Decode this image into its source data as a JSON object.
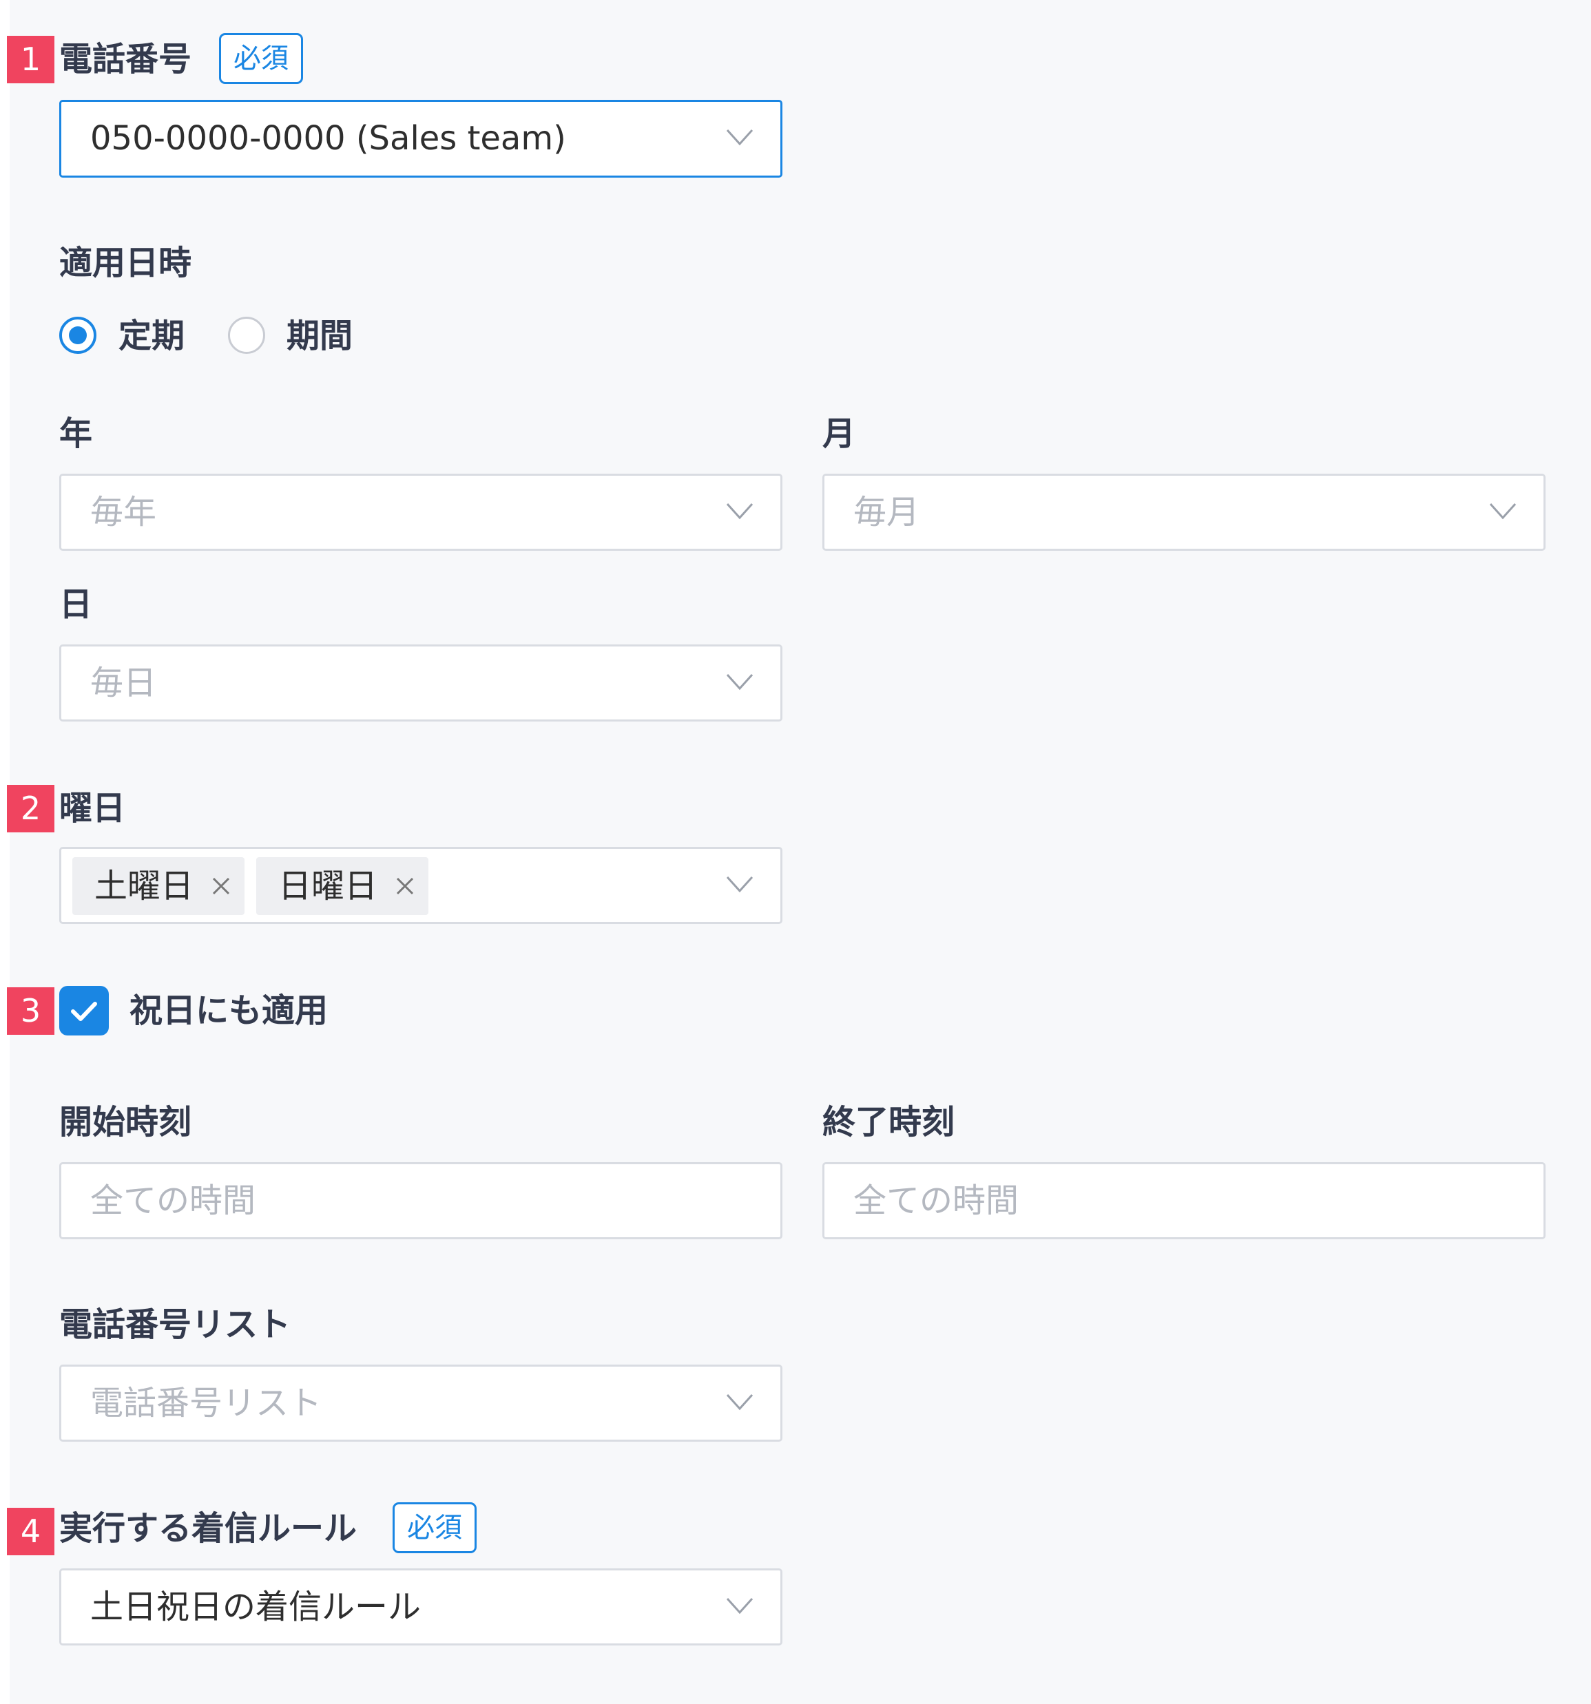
{
  "sections": {
    "phone": {
      "marker": "1",
      "label": "電話番号",
      "required_badge": "必須",
      "value": "050-0000-0000 (Sales team)"
    },
    "apply_datetime": {
      "label": "適用日時",
      "options": [
        {
          "label": "定期",
          "selected": true
        },
        {
          "label": "期間",
          "selected": false
        }
      ]
    },
    "year": {
      "label": "年",
      "placeholder": "毎年"
    },
    "month": {
      "label": "月",
      "placeholder": "毎月"
    },
    "day": {
      "label": "日",
      "placeholder": "毎日"
    },
    "weekday": {
      "marker": "2",
      "label": "曜日",
      "chips": [
        "土曜日",
        "日曜日"
      ]
    },
    "holiday": {
      "marker": "3",
      "label": "祝日にも適用",
      "checked": true
    },
    "start_time": {
      "label": "開始時刻",
      "placeholder": "全ての時間"
    },
    "end_time": {
      "label": "終了時刻",
      "placeholder": "全ての時間"
    },
    "phone_list": {
      "label": "電話番号リスト",
      "placeholder": "電話番号リスト"
    },
    "rule": {
      "marker": "4",
      "label": "実行する着信ルール",
      "required_badge": "必須",
      "value": "土日祝日の着信ルール"
    }
  },
  "colors": {
    "accent": "#1a86e3",
    "marker": "#f0445f",
    "background": "#f7f8fa",
    "placeholder": "#b4b8c0"
  },
  "icons": {
    "dropdown": "chevron-down-icon",
    "chip_remove": "close-icon",
    "checkbox": "check-icon"
  }
}
